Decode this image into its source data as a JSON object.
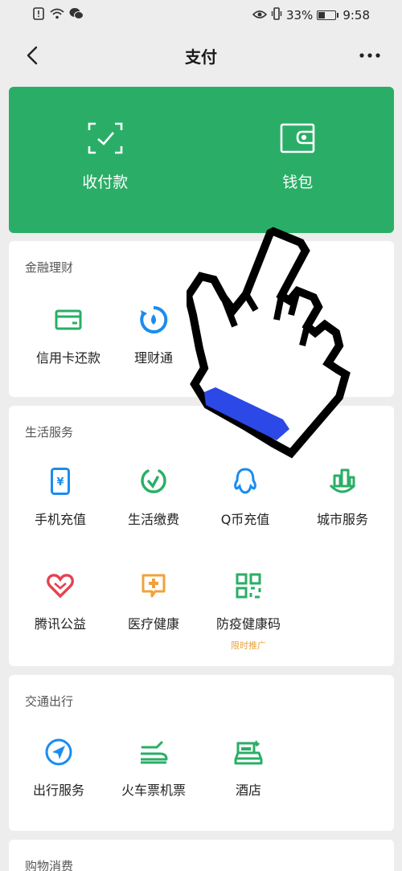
{
  "status_bar": {
    "battery": "33%",
    "time": "9:58"
  },
  "navbar": {
    "title": "支付"
  },
  "hero": [
    {
      "label": "收付款",
      "icon": "scan-pay-icon"
    },
    {
      "label": "钱包",
      "icon": "wallet-icon"
    }
  ],
  "finance": {
    "title": "金融理财",
    "items": [
      {
        "label": "信用卡还款",
        "icon": "credit-card-icon"
      },
      {
        "label": "理财通",
        "icon": "wealth-icon"
      }
    ]
  },
  "life": {
    "title": "生活服务",
    "items": [
      {
        "label": "手机充值",
        "icon": "phone-icon"
      },
      {
        "label": "生活缴费",
        "icon": "bill-pay-icon"
      },
      {
        "label": "Q币充值",
        "icon": "qq-icon"
      },
      {
        "label": "城市服务",
        "icon": "city-icon"
      },
      {
        "label": "腾讯公益",
        "icon": "charity-icon"
      },
      {
        "label": "医疗健康",
        "icon": "medical-icon"
      },
      {
        "label": "防疫健康码",
        "icon": "qrcode-icon",
        "badge": "限时推广"
      }
    ]
  },
  "transport": {
    "title": "交通出行",
    "items": [
      {
        "label": "出行服务",
        "icon": "navigation-icon"
      },
      {
        "label": "火车票机票",
        "icon": "train-plane-icon"
      },
      {
        "label": "酒店",
        "icon": "hotel-icon"
      }
    ]
  },
  "shopping": {
    "title": "购物消费"
  },
  "colors": {
    "accent": "#2aae67",
    "blue": "#1a8cf0",
    "red": "#e4424f",
    "orange": "#f0a23a",
    "green": "#2aae67"
  }
}
